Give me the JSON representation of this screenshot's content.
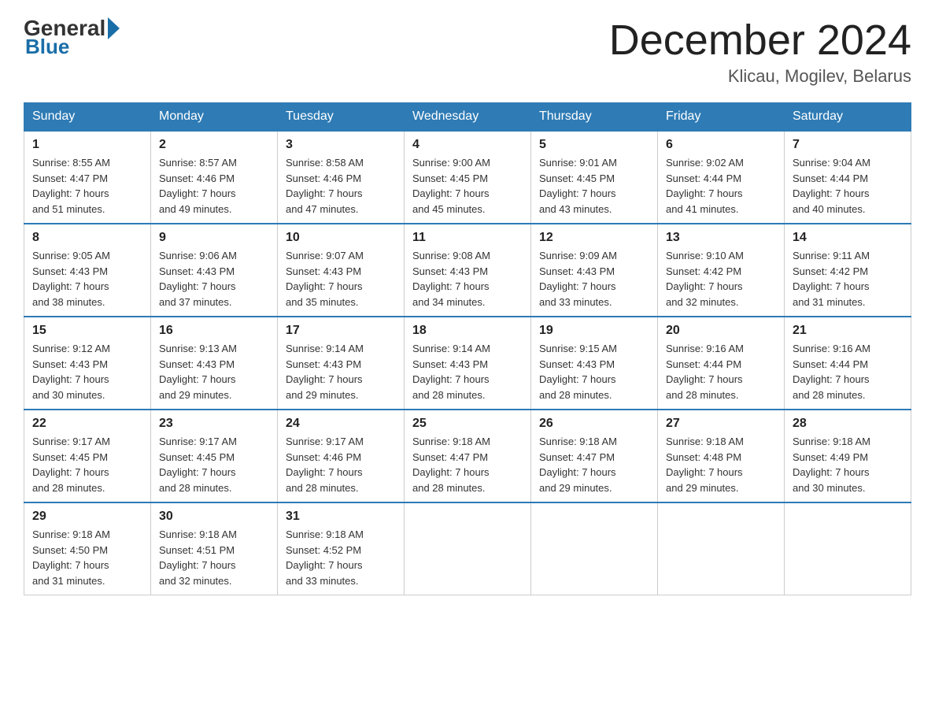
{
  "header": {
    "logo_general": "General",
    "logo_blue": "Blue",
    "month_title": "December 2024",
    "location": "Klicau, Mogilev, Belarus"
  },
  "days_of_week": [
    "Sunday",
    "Monday",
    "Tuesday",
    "Wednesday",
    "Thursday",
    "Friday",
    "Saturday"
  ],
  "weeks": [
    [
      {
        "day": "1",
        "sunrise": "Sunrise: 8:55 AM",
        "sunset": "Sunset: 4:47 PM",
        "daylight": "Daylight: 7 hours",
        "daylight2": "and 51 minutes."
      },
      {
        "day": "2",
        "sunrise": "Sunrise: 8:57 AM",
        "sunset": "Sunset: 4:46 PM",
        "daylight": "Daylight: 7 hours",
        "daylight2": "and 49 minutes."
      },
      {
        "day": "3",
        "sunrise": "Sunrise: 8:58 AM",
        "sunset": "Sunset: 4:46 PM",
        "daylight": "Daylight: 7 hours",
        "daylight2": "and 47 minutes."
      },
      {
        "day": "4",
        "sunrise": "Sunrise: 9:00 AM",
        "sunset": "Sunset: 4:45 PM",
        "daylight": "Daylight: 7 hours",
        "daylight2": "and 45 minutes."
      },
      {
        "day": "5",
        "sunrise": "Sunrise: 9:01 AM",
        "sunset": "Sunset: 4:45 PM",
        "daylight": "Daylight: 7 hours",
        "daylight2": "and 43 minutes."
      },
      {
        "day": "6",
        "sunrise": "Sunrise: 9:02 AM",
        "sunset": "Sunset: 4:44 PM",
        "daylight": "Daylight: 7 hours",
        "daylight2": "and 41 minutes."
      },
      {
        "day": "7",
        "sunrise": "Sunrise: 9:04 AM",
        "sunset": "Sunset: 4:44 PM",
        "daylight": "Daylight: 7 hours",
        "daylight2": "and 40 minutes."
      }
    ],
    [
      {
        "day": "8",
        "sunrise": "Sunrise: 9:05 AM",
        "sunset": "Sunset: 4:43 PM",
        "daylight": "Daylight: 7 hours",
        "daylight2": "and 38 minutes."
      },
      {
        "day": "9",
        "sunrise": "Sunrise: 9:06 AM",
        "sunset": "Sunset: 4:43 PM",
        "daylight": "Daylight: 7 hours",
        "daylight2": "and 37 minutes."
      },
      {
        "day": "10",
        "sunrise": "Sunrise: 9:07 AM",
        "sunset": "Sunset: 4:43 PM",
        "daylight": "Daylight: 7 hours",
        "daylight2": "and 35 minutes."
      },
      {
        "day": "11",
        "sunrise": "Sunrise: 9:08 AM",
        "sunset": "Sunset: 4:43 PM",
        "daylight": "Daylight: 7 hours",
        "daylight2": "and 34 minutes."
      },
      {
        "day": "12",
        "sunrise": "Sunrise: 9:09 AM",
        "sunset": "Sunset: 4:43 PM",
        "daylight": "Daylight: 7 hours",
        "daylight2": "and 33 minutes."
      },
      {
        "day": "13",
        "sunrise": "Sunrise: 9:10 AM",
        "sunset": "Sunset: 4:42 PM",
        "daylight": "Daylight: 7 hours",
        "daylight2": "and 32 minutes."
      },
      {
        "day": "14",
        "sunrise": "Sunrise: 9:11 AM",
        "sunset": "Sunset: 4:42 PM",
        "daylight": "Daylight: 7 hours",
        "daylight2": "and 31 minutes."
      }
    ],
    [
      {
        "day": "15",
        "sunrise": "Sunrise: 9:12 AM",
        "sunset": "Sunset: 4:43 PM",
        "daylight": "Daylight: 7 hours",
        "daylight2": "and 30 minutes."
      },
      {
        "day": "16",
        "sunrise": "Sunrise: 9:13 AM",
        "sunset": "Sunset: 4:43 PM",
        "daylight": "Daylight: 7 hours",
        "daylight2": "and 29 minutes."
      },
      {
        "day": "17",
        "sunrise": "Sunrise: 9:14 AM",
        "sunset": "Sunset: 4:43 PM",
        "daylight": "Daylight: 7 hours",
        "daylight2": "and 29 minutes."
      },
      {
        "day": "18",
        "sunrise": "Sunrise: 9:14 AM",
        "sunset": "Sunset: 4:43 PM",
        "daylight": "Daylight: 7 hours",
        "daylight2": "and 28 minutes."
      },
      {
        "day": "19",
        "sunrise": "Sunrise: 9:15 AM",
        "sunset": "Sunset: 4:43 PM",
        "daylight": "Daylight: 7 hours",
        "daylight2": "and 28 minutes."
      },
      {
        "day": "20",
        "sunrise": "Sunrise: 9:16 AM",
        "sunset": "Sunset: 4:44 PM",
        "daylight": "Daylight: 7 hours",
        "daylight2": "and 28 minutes."
      },
      {
        "day": "21",
        "sunrise": "Sunrise: 9:16 AM",
        "sunset": "Sunset: 4:44 PM",
        "daylight": "Daylight: 7 hours",
        "daylight2": "and 28 minutes."
      }
    ],
    [
      {
        "day": "22",
        "sunrise": "Sunrise: 9:17 AM",
        "sunset": "Sunset: 4:45 PM",
        "daylight": "Daylight: 7 hours",
        "daylight2": "and 28 minutes."
      },
      {
        "day": "23",
        "sunrise": "Sunrise: 9:17 AM",
        "sunset": "Sunset: 4:45 PM",
        "daylight": "Daylight: 7 hours",
        "daylight2": "and 28 minutes."
      },
      {
        "day": "24",
        "sunrise": "Sunrise: 9:17 AM",
        "sunset": "Sunset: 4:46 PM",
        "daylight": "Daylight: 7 hours",
        "daylight2": "and 28 minutes."
      },
      {
        "day": "25",
        "sunrise": "Sunrise: 9:18 AM",
        "sunset": "Sunset: 4:47 PM",
        "daylight": "Daylight: 7 hours",
        "daylight2": "and 28 minutes."
      },
      {
        "day": "26",
        "sunrise": "Sunrise: 9:18 AM",
        "sunset": "Sunset: 4:47 PM",
        "daylight": "Daylight: 7 hours",
        "daylight2": "and 29 minutes."
      },
      {
        "day": "27",
        "sunrise": "Sunrise: 9:18 AM",
        "sunset": "Sunset: 4:48 PM",
        "daylight": "Daylight: 7 hours",
        "daylight2": "and 29 minutes."
      },
      {
        "day": "28",
        "sunrise": "Sunrise: 9:18 AM",
        "sunset": "Sunset: 4:49 PM",
        "daylight": "Daylight: 7 hours",
        "daylight2": "and 30 minutes."
      }
    ],
    [
      {
        "day": "29",
        "sunrise": "Sunrise: 9:18 AM",
        "sunset": "Sunset: 4:50 PM",
        "daylight": "Daylight: 7 hours",
        "daylight2": "and 31 minutes."
      },
      {
        "day": "30",
        "sunrise": "Sunrise: 9:18 AM",
        "sunset": "Sunset: 4:51 PM",
        "daylight": "Daylight: 7 hours",
        "daylight2": "and 32 minutes."
      },
      {
        "day": "31",
        "sunrise": "Sunrise: 9:18 AM",
        "sunset": "Sunset: 4:52 PM",
        "daylight": "Daylight: 7 hours",
        "daylight2": "and 33 minutes."
      },
      null,
      null,
      null,
      null
    ]
  ]
}
